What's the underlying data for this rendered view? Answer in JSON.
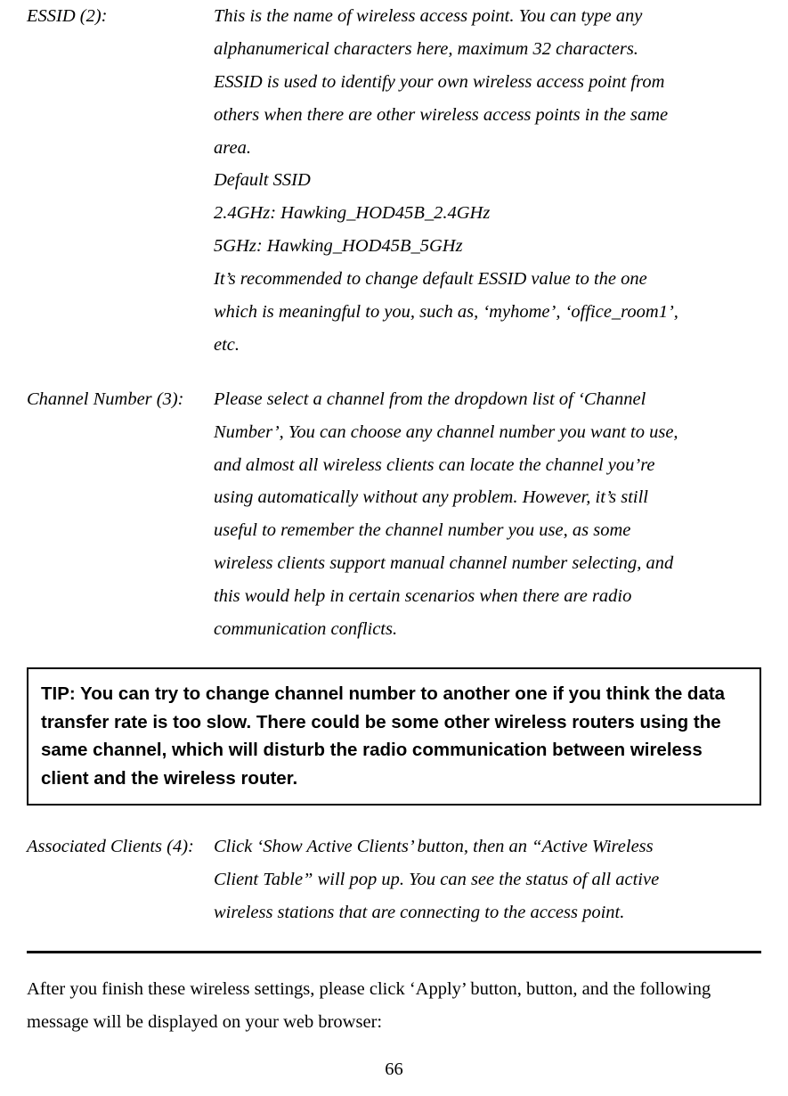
{
  "definitions": {
    "essid": {
      "label": "ESSID (2):",
      "l1": "This is the name of wireless access point. You can type any",
      "l2": "alphanumerical characters here, maximum 32 characters.",
      "l3": "ESSID is used to identify your own wireless access point from",
      "l4": "others when there are other wireless access points in the same",
      "l5": "area.",
      "l6": "Default SSID",
      "l7": "2.4GHz: Hawking_HOD45B_2.4GHz",
      "l8": "5GHz: Hawking_HOD45B_5GHz",
      "l9": "It’s recommended to change default ESSID value to the one",
      "l10": "which is meaningful to you, such as, ‘myhome’, ‘office_room1’,",
      "l11": "etc."
    },
    "channel": {
      "label": "Channel Number (3):",
      "l1": "Please select a channel from the dropdown list of ‘Channel",
      "l2": "Number’, You can choose any channel number you want to use,",
      "l3": "and almost all wireless clients can locate the channel you’re",
      "l4": "using automatically without any problem. However, it’s still",
      "l5": "useful to remember the channel number you use, as some",
      "l6": "wireless clients support manual channel number selecting, and",
      "l7": "this would help in certain scenarios when there are radio",
      "l8": "communication conflicts."
    },
    "associated": {
      "label": "Associated Clients (4):",
      "l1": "Click ‘Show Active Clients’ button, then an “Active Wireless",
      "l2": "Client Table” will pop up. You can see the status of all active",
      "l3": "wireless stations that are connecting to the access point."
    }
  },
  "tip": "TIP: You can try to change channel number to another one if you think the data transfer rate is too slow. There could be some other wireless routers using the same channel, which will disturb the radio communication between wireless client and the wireless router.",
  "closing": "After you finish these wireless settings, please click ‘Apply’ button, button, and the following message will be displayed on your web browser:",
  "pageNumber": "66"
}
